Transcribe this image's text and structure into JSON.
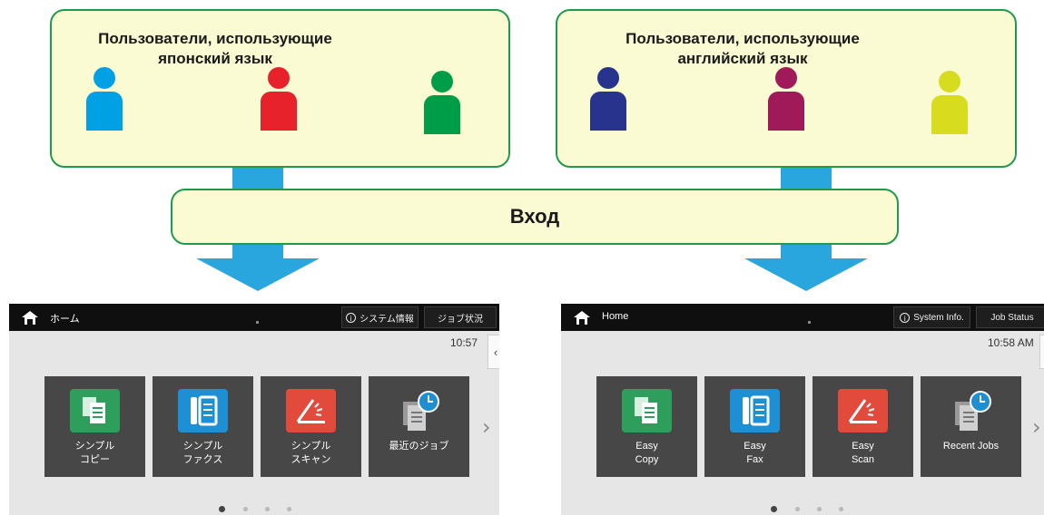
{
  "groups": [
    {
      "title": "Пользователи, использующие\nяпонский язык",
      "user_colors": [
        "#00a1e4",
        "#e7222b",
        "#009d49"
      ]
    },
    {
      "title": "Пользователи, использующие\nанглийский язык",
      "user_colors": [
        "#27338c",
        "#a01a5a",
        "#d7dc1f"
      ]
    }
  ],
  "login_label": "Вход",
  "screens": [
    {
      "home_label": "ホーム",
      "system_info": "システム情報",
      "job_status": "ジョブ状況",
      "time": "10:57",
      "side_tab_glyph": "‹",
      "tiles": [
        {
          "label": "シンプル\nコピー",
          "icon": "copy-icon"
        },
        {
          "label": "シンプル\nファクス",
          "icon": "fax-icon"
        },
        {
          "label": "シンプル\nスキャン",
          "icon": "scan-icon"
        },
        {
          "label": "最近のジョブ",
          "icon": "recent-jobs-icon"
        }
      ],
      "next_glyph": "›",
      "page_count": 4,
      "current_page": 1
    },
    {
      "home_label": "Home",
      "system_info": "System Info.",
      "job_status": "Job Status",
      "time": "10:58 AM",
      "side_tab_glyph": "‹",
      "tiles": [
        {
          "label": "Easy\nCopy",
          "icon": "copy-icon"
        },
        {
          "label": "Easy\nFax",
          "icon": "fax-icon"
        },
        {
          "label": "Easy\nScan",
          "icon": "scan-icon"
        },
        {
          "label": "Recent Jobs",
          "icon": "recent-jobs-icon"
        }
      ],
      "next_glyph": "›",
      "page_count": 4,
      "current_page": 1
    }
  ],
  "colors": {
    "arrow": "#2aa6de",
    "box_fill": "#fbfbd3",
    "box_border": "#1f9a4b"
  }
}
